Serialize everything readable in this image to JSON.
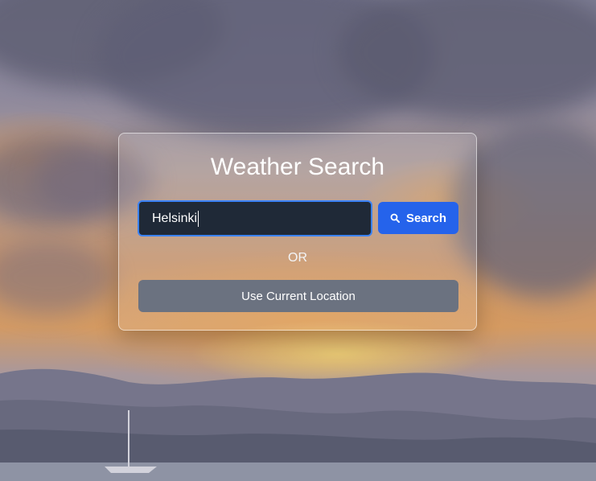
{
  "page": {
    "title": "Weather Search"
  },
  "search": {
    "value": "Helsinki",
    "button_label": "Search",
    "icon": "search-icon"
  },
  "divider_text": "OR",
  "location": {
    "button_label": "Use Current Location"
  },
  "colors": {
    "input_bg": "#1f2937",
    "input_border": "#3b82f6",
    "search_button": "#2563eb",
    "location_button": "#6b7280"
  }
}
